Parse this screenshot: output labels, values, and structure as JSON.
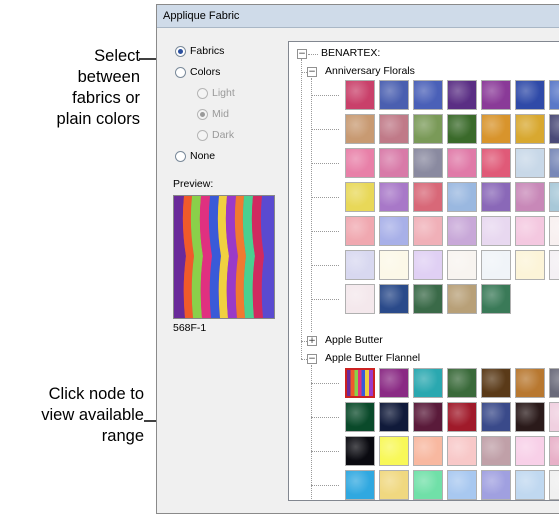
{
  "callouts": {
    "select_text": "Select between fabrics or plain colors",
    "select_lines": [
      "Select",
      "between",
      "fabrics or",
      "plain colors"
    ],
    "click_lines": [
      "Click node to",
      "view available",
      "range"
    ]
  },
  "dialog": {
    "title": "Applique Fabric",
    "options": {
      "fabrics": "Fabrics",
      "colors": "Colors",
      "light": "Light",
      "mid": "Mid",
      "dark": "Dark",
      "none": "None"
    },
    "preview_label": "Preview:",
    "preview_code": "568F-1"
  },
  "tree": {
    "root": "BENARTEX:",
    "groups": [
      {
        "label": "Anniversary Florals",
        "expanded": true
      },
      {
        "label": "Apple Butter",
        "expanded": false
      },
      {
        "label": "Apple Butter Flannel",
        "expanded": true
      }
    ],
    "anniversary_swatch_rows": [
      [
        "#c9406a",
        "#4a5fb0",
        "#4a60b8",
        "#5a2e84",
        "#8a3a98",
        "#2f4aa8",
        "#5a78c8"
      ],
      [
        "#c89a72",
        "#c07a88",
        "#7a9a58",
        "#3a6a2a",
        "#d8942c",
        "#d8a830",
        "#4a4a78"
      ],
      [
        "#e880a8",
        "#d87aa8",
        "#8a8aa0",
        "#e07aa8",
        "#e05a78",
        "#c8d8e8",
        "#7888b8"
      ],
      [
        "#e8d858",
        "#a878c8",
        "#d86878",
        "#9ab8e0",
        "#8a68b8",
        "#c888b8",
        "#a8c8d8"
      ],
      [
        "#f0a8b0",
        "#a8b0e8",
        "#f0b0b8",
        "#c8a8d8",
        "#e8d8f0",
        "#f4c8e0",
        "#f8f0f0"
      ],
      [
        "#d8d8f0",
        "#fcf8e8",
        "#e0d0f4",
        "#f8f4f0",
        "#f0f4f8",
        "#fcf4d8",
        "#f4f0f4"
      ],
      [
        "#f4e8ec",
        "#2a4a8a",
        "#3a6a48",
        "#b8a078",
        "#3a7a58"
      ]
    ],
    "flannel_swatch_rows": [
      [
        "stripe",
        "#8a2a84",
        "#2aa8b0",
        "#3a6a3a",
        "#5a3a18",
        "#b87830",
        "#6a6a7a"
      ],
      [
        "#0a4a2a",
        "#101a3a",
        "#5a1a3a",
        "#a01a2a",
        "#3a4a8a",
        "#2a1a1a",
        "#f0d0e0"
      ],
      [
        "#0a0a10",
        "#f8f858",
        "#f8b8a0",
        "#f8c8c8",
        "#c0a0a8",
        "#f8d0e8",
        "#e8b0c8"
      ],
      [
        "#30a8e0",
        "#f0d880",
        "#70e0a8",
        "#a8c8f0",
        "#a0a0e0",
        "#c0d8f0",
        "#f0f0f0"
      ]
    ]
  },
  "colors": {
    "title_bar": "#cfdbe9",
    "selection_border": "#cc2222",
    "radio_dot": "#2a4f9e"
  }
}
